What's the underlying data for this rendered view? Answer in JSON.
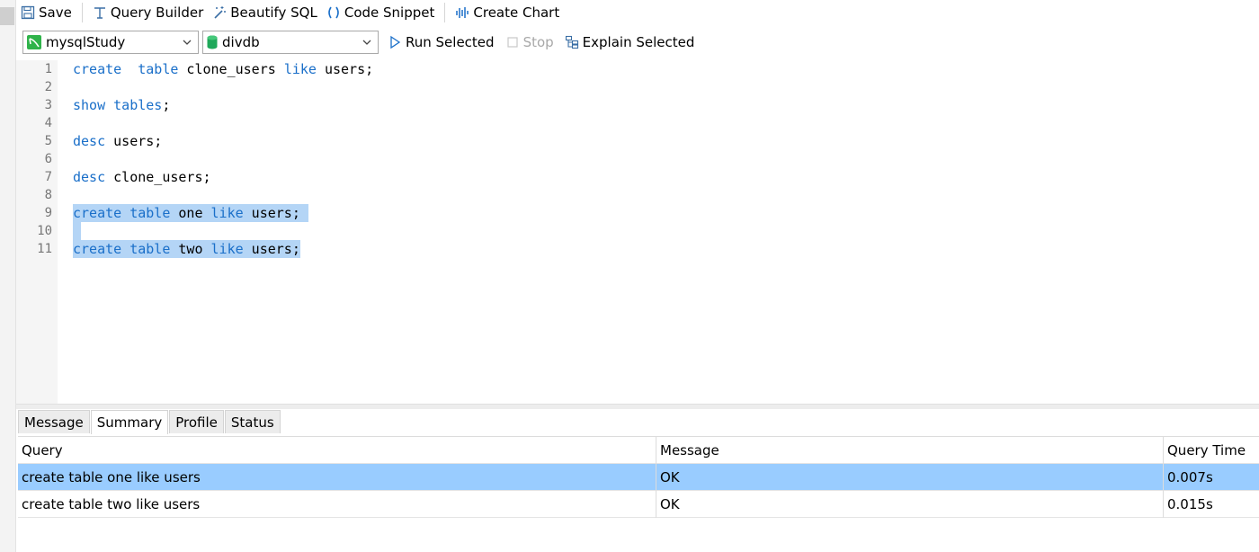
{
  "toolbar": {
    "save": "Save",
    "query_builder": "Query Builder",
    "beautify_sql": "Beautify SQL",
    "code_snippet": "Code Snippet",
    "create_chart": "Create Chart"
  },
  "toolbar2": {
    "connection": "mysqlStudy",
    "database": "divdb",
    "run_selected": "Run Selected",
    "stop": "Stop",
    "explain_selected": "Explain Selected"
  },
  "editor": {
    "line_numbers": [
      "1",
      "2",
      "3",
      "4",
      "5",
      "6",
      "7",
      "8",
      "9",
      "10",
      "11"
    ],
    "lines": {
      "l1": {
        "k1": "create",
        "s1": "  ",
        "k2": "table",
        "t1": " clone_users ",
        "k3": "like",
        "t2": " users;"
      },
      "l3": {
        "k1": "show",
        "s1": " ",
        "k2": "tables",
        "t1": ";"
      },
      "l5": {
        "k1": "desc",
        "t1": " users;"
      },
      "l7": {
        "k1": "desc",
        "t1": " clone_users;"
      },
      "l9": {
        "k1": "create",
        "s1": " ",
        "k2": "table",
        "t1": " one ",
        "k3": "like",
        "t2": " users; "
      },
      "l11": {
        "k1": "create",
        "s1": " ",
        "k2": "table",
        "t1": " two ",
        "k3": "like",
        "t2": " users;"
      }
    }
  },
  "result_tabs": [
    "Message",
    "Summary",
    "Profile",
    "Status"
  ],
  "result_grid": {
    "columns": [
      "Query",
      "Message",
      "Query Time"
    ],
    "rows": [
      {
        "query": "create table one like users",
        "message": "OK",
        "time": "0.007s"
      },
      {
        "query": "create table two like users",
        "message": "OK",
        "time": "0.015s"
      }
    ]
  },
  "colors": {
    "keyword": "#1a6fc9",
    "selection": "#b4d5f6",
    "selected_row": "#99ccff"
  },
  "icons": [
    "save-icon",
    "query-builder-icon",
    "beautify-icon",
    "code-snippet-icon",
    "create-chart-icon",
    "connection-icon",
    "database-icon",
    "play-icon",
    "stop-icon",
    "explain-icon",
    "chevron-down-icon"
  ]
}
